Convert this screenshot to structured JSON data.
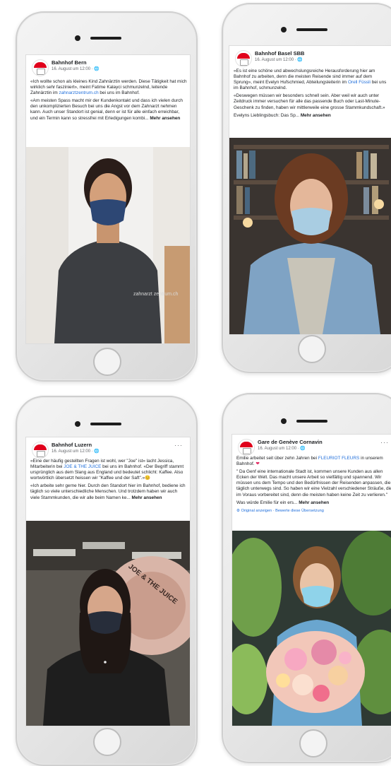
{
  "posts": [
    {
      "page_name": "Bahnhof Bern",
      "date": "16. August um 12:00 · ",
      "p1_a": "«Ich wollte schon als kleines Kind Zahnärztin werden. Diese Tätigkeit hat mich wirklich sehr fasziniert», meint Fatime Kalayci schmunzelnd, leitende Zahnärztin im ",
      "p1_link": "zahnarztzentrum.ch",
      "p1_b": " bei uns im Bahnhof.",
      "p2": "«Am meisten Spass macht mir der Kundenkontakt und dass ich vielen durch den unkomplizierten Besuch bei uns die Angst vor dem Zahnarzt nehmen kann. Auch unser Standort ist genial, denn er ist für alle einfach erreichbar, und ein Termin kann so stressfrei mit Erledigungen kombi... ",
      "more": "Mehr ansehen",
      "mask_text": "zahnarzt zentrum.ch"
    },
    {
      "page_name": "Bahnhof Basel SBB",
      "date": "16. August um 12:00 · ",
      "p1_a": "«Es ist eine schöne und abwechslungsreiche Herausforderung hier am Bahnhof zu arbeiten, denn die meisten Reisende sind immer auf dem Sprung», meint Evelyn Hufschmied, Abteilungsleiterin im ",
      "p1_link": "Orell Füssli",
      "p1_b": " bei uns im Bahnhof, schmunzelnd.",
      "p2": "«Deswegen müssen wir besonders schnell sein. Aber weil wir auch unter Zeitdruck immer versuchen für alle das passende Buch oder Last-Minute-Geschenk zu finden, haben wir mittlerweile eine grosse Stammkundschaft.»",
      "p3": "Evelyns Lieblingsbuch: Das Sp... ",
      "more": "Mehr ansehen"
    },
    {
      "page_name": "Bahnhof Luzern",
      "date": "16. August um 12:00 · ",
      "p1_a": "«Eine der häufig gestellten Fragen ist wohl, wer \"Joe\" ist» lacht Jessica, Mitarbeiterin bei ",
      "p1_link": "JOE & THE JUICE",
      "p1_b": " bei uns im Bahnhof. «Der Begriff stammt ursprünglich aus dem Slang aus England und bedeutet schlicht: Kaffee. Also wortwörtlich übersetzt heissen wir \"Kaffee und der Saft\".»",
      "p2": "«Ich arbeite sehr gerne hier. Durch den Standort hier im Bahnhof, bediene ich täglich so viele unterschiedliche Menschen. Und trotzdem haben wir auch viele Stammkunden, die wir alle beim Namen ke... ",
      "more": "Mehr ansehen",
      "wall_text": "JOE & THE JUICE"
    },
    {
      "page_name": "Gare de Genève Cornavin",
      "date": "16. August um 12:00 · ",
      "p1_a": "Emilie arbeitet seit über zehn Jahren bei ",
      "p1_link": "FLEURIOT FLEURS",
      "p1_b": " in unserem Bahnhof. ",
      "p2": "\" Da Genf eine internationale Stadt ist, kommen unsere Kunden aus allen Ecken der Welt. Das macht unsere Arbeit so vielfältig und spannend. Wir müssen uns dem Tempo und den Bedürfnissen der Reisenden anpassen, die täglich unterwegs sind. So haben wir eine Vielzahl verschiedener Sträuße, die im Voraus vorbereitet sind, denn die meisten haben keine Zeit zu verlieren.\"",
      "p3": "Was würde Emilie für ein ers... ",
      "more": "Mehr ansehen",
      "translation": "Original anzeigen · Bewerte diese Übersetzung"
    }
  ],
  "icons": {
    "globe": "globe-icon",
    "heart": "heart-emoji-icon",
    "smile": "smile-emoji-icon"
  }
}
